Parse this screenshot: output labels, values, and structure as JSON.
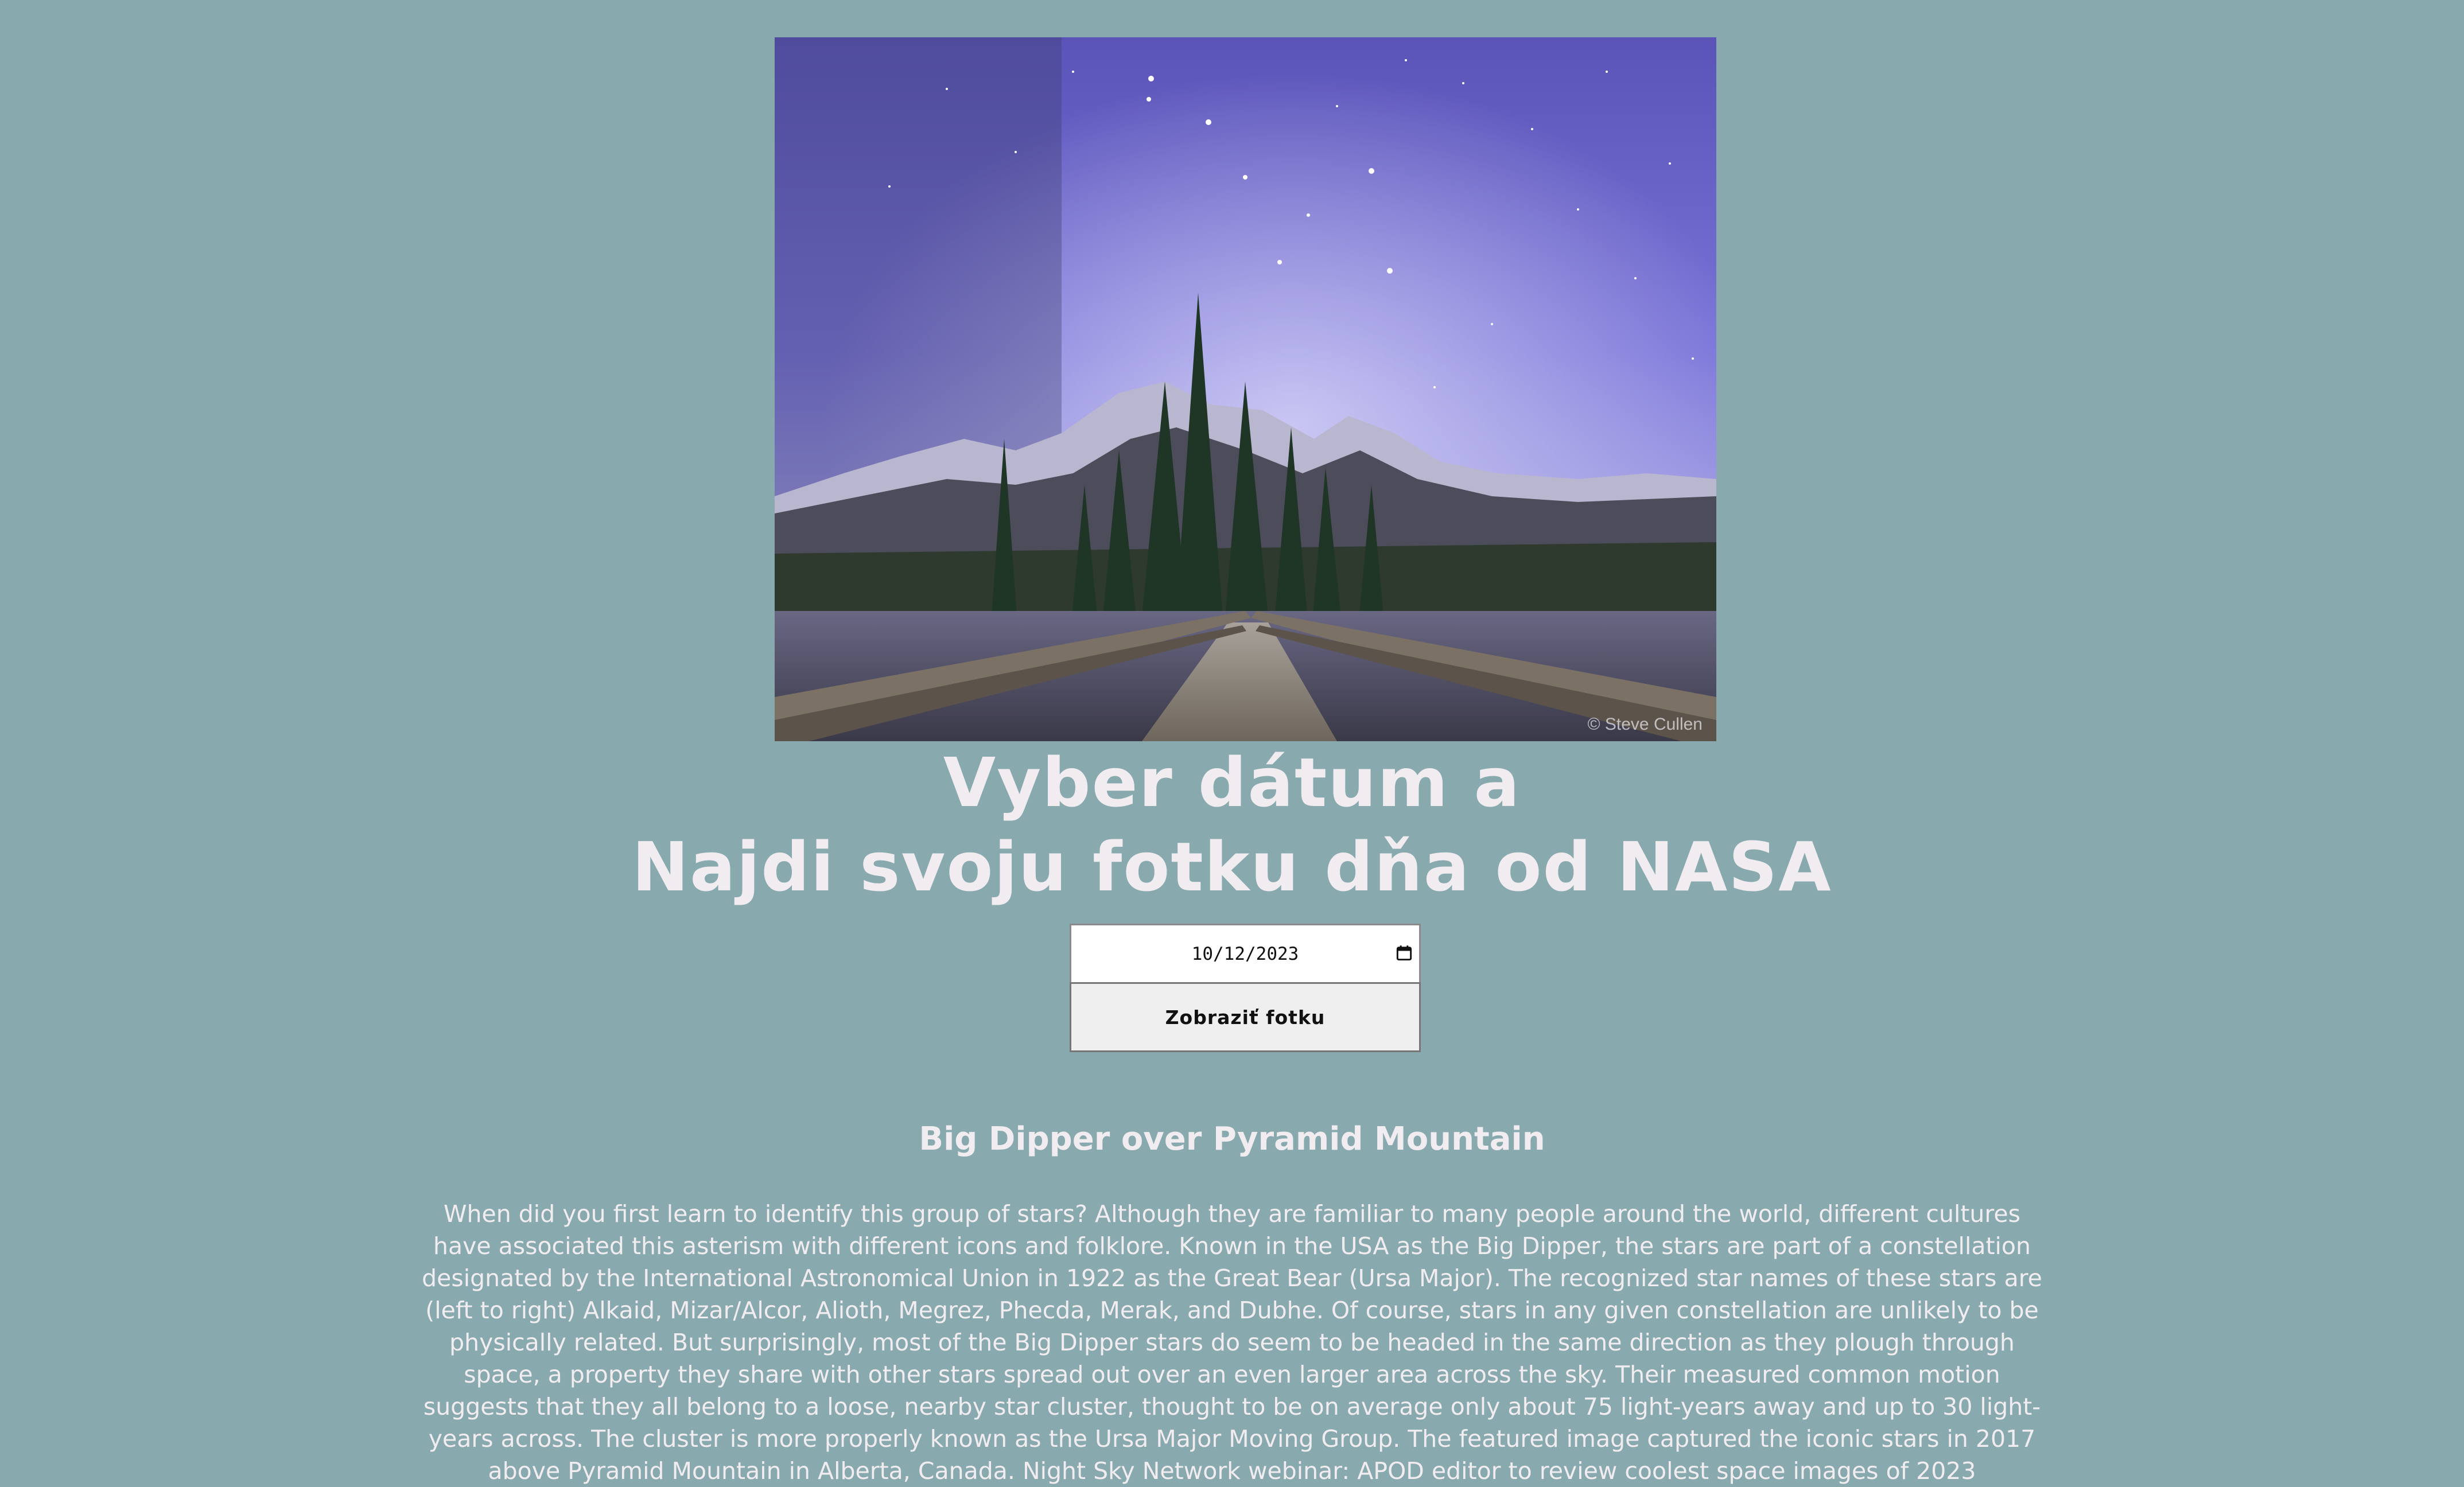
{
  "hero_image": {
    "credit": "© Steve Cullen"
  },
  "heading": {
    "line1": "Vyber dátum a",
    "line2": "Najdi svoju fotku dňa od NASA"
  },
  "form": {
    "date_value": "10/12/2023",
    "calendar_icon": "calendar-icon",
    "submit_label": "Zobraziť fotku"
  },
  "apod": {
    "title": "Big Dipper over Pyramid Mountain",
    "explanation": "When did you first learn to identify this group of stars? Although they are familiar to many people around the world, different cultures have associated this asterism with different icons and folklore. Known in the USA as the Big Dipper, the stars are part of a constellation designated by the International Astronomical Union in 1922 as the Great Bear (Ursa Major). The recognized star names of these stars are (left to right) Alkaid, Mizar/Alcor, Alioth, Megrez, Phecda, Merak, and Dubhe. Of course, stars in any given constellation are unlikely to be physically related. But surprisingly, most of the Big Dipper stars do seem to be headed in the same direction as they plough through space, a property they share with other stars spread out over an even larger area across the sky. Their measured common motion suggests that they all belong to a loose, nearby star cluster, thought to be on average only about 75 light-years away and up to 30 light-years across. The cluster is more properly known as the Ursa Major Moving Group. The featured image captured the iconic stars in 2017 above Pyramid Mountain in Alberta, Canada. Night Sky Network webinar: APOD editor to review coolest space images of 2023"
  }
}
